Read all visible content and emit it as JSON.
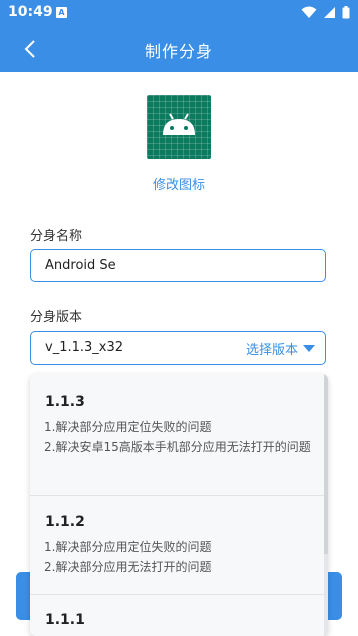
{
  "status_bar": {
    "time": "10:49",
    "notif_badge": "A"
  },
  "app_bar": {
    "title": "制作分身"
  },
  "icon_section": {
    "change_icon": "修改图标"
  },
  "form": {
    "name_label": "分身名称",
    "name_value": "Android Se",
    "version_label": "分身版本",
    "version_value": "v_1.1.3_x32",
    "select_version": "选择版本"
  },
  "versions": [
    {
      "title": "1.1.3",
      "note1": "1.解决部分应用定位失败的问题",
      "note2": " 2.解决安卓15高版本手机部分应用无法打开的问题"
    },
    {
      "title": "1.1.2",
      "note1": "1.解决部分应用定位失败的问题",
      "note2": " 2.解决部分应用无法打开的问题"
    },
    {
      "title": "1.1.1"
    }
  ],
  "colors": {
    "accent": "#3a8ee6",
    "icon_bg": "#0b7a5f"
  }
}
